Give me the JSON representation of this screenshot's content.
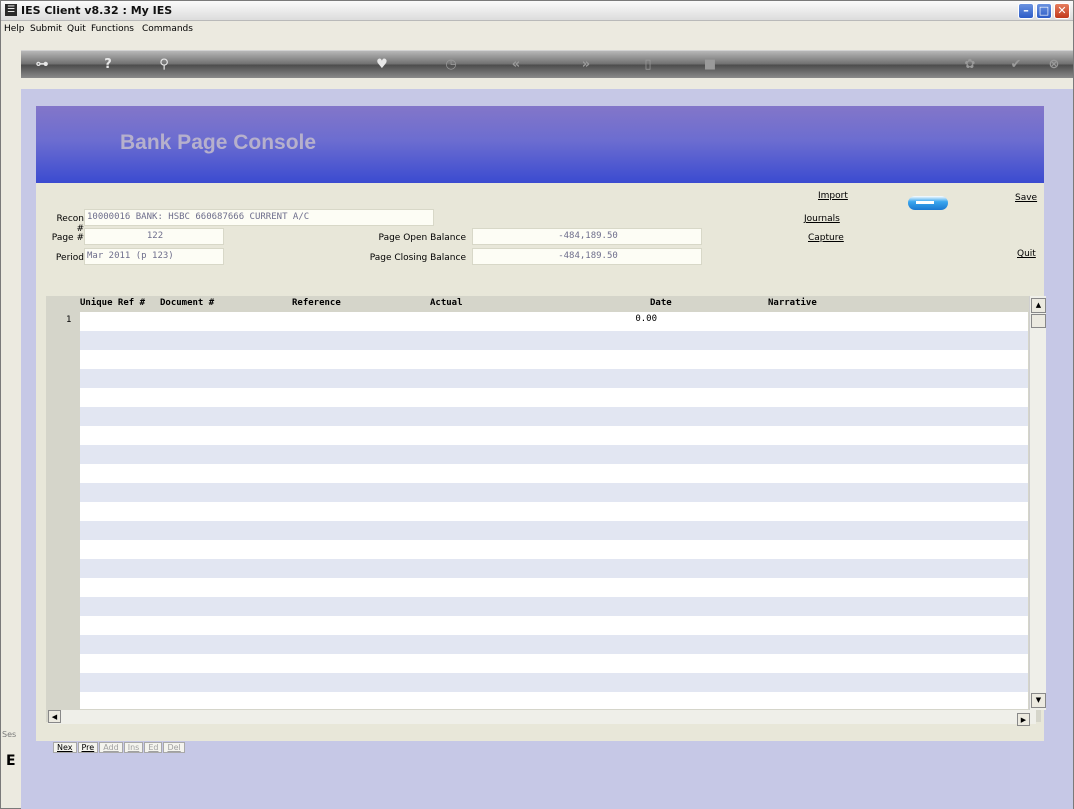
{
  "window": {
    "title": "IES Client v8.32 : My IES",
    "icon": "app-icon",
    "controls": [
      "minimize",
      "maximize",
      "close"
    ]
  },
  "menu": [
    "Help",
    "Submit",
    "Quit",
    "Functions",
    "Commands"
  ],
  "toolbar": {
    "icons": [
      "key-icon",
      "help-icon",
      "search-icon",
      "heart-icon",
      "clock-icon",
      "back-icon",
      "forward-icon",
      "list-icon",
      "stop-icon",
      "flower-icon",
      "check-icon",
      "close-icon"
    ]
  },
  "banner": {
    "title": "Bank Page Console"
  },
  "form": {
    "recon_label": "Recon #",
    "recon_value": "10000016 BANK: HSBC 660687666 CURRENT A/C",
    "page_label": "Page #",
    "page_value": "122",
    "period_label": "Period",
    "period_value": "Mar 2011 (p 123)",
    "open_label": "Page Open Balance",
    "open_value": "-484,189.50",
    "closing_label": "Page Closing Balance",
    "closing_value": "-484,189.50"
  },
  "actions": {
    "import": "Import",
    "journals": "Journals",
    "capture": "Capture",
    "save": "Save",
    "quit": "Quit"
  },
  "grid": {
    "columns": [
      "Unique Ref #",
      "Document #",
      "Reference",
      "Actual",
      "Date",
      "Narrative"
    ],
    "rows": [
      {
        "num": "1",
        "actual": "0.00"
      }
    ]
  },
  "bottom_nav": [
    "Nex",
    "Pre",
    "Add",
    "Ins",
    "Ed",
    "Del"
  ],
  "side": {
    "ses": "Ses",
    "e": "E"
  },
  "colors": {
    "banner_top": "#8376c9",
    "banner_bottom": "#3b4bd0",
    "content_bg": "#c6c8e6",
    "panel_bg": "#e8e7d9",
    "row_alt": "#e2e6f2"
  }
}
